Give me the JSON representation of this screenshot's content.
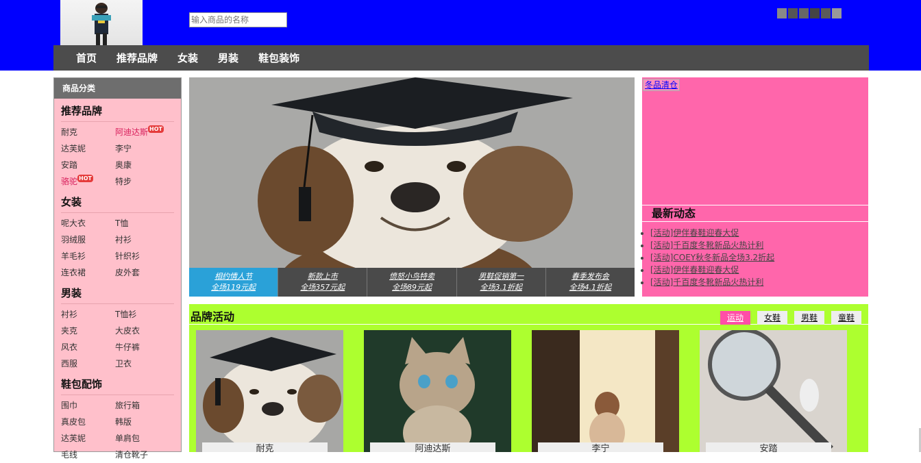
{
  "header": {
    "search_placeholder": "输入商品的名称",
    "nav": [
      "首页",
      "推荐品牌",
      "女装",
      "男装",
      "鞋包装饰"
    ]
  },
  "sidebar": {
    "title": "商品分类",
    "categories": [
      {
        "title": "推荐品牌",
        "items": [
          "耐克",
          "阿迪达斯",
          "达芙妮",
          "李宁",
          "安踏",
          "奥康",
          "骆驼",
          "特步"
        ]
      },
      {
        "title": "女装",
        "items": [
          "呢大衣",
          "T恤",
          "羽绒服",
          "衬衫",
          "羊毛衫",
          "针织衫",
          "连衣裙",
          "皮外套"
        ]
      },
      {
        "title": "男装",
        "items": [
          "衬衫",
          "T恤衫",
          "夹克",
          "大皮衣",
          "风衣",
          "牛仔裤",
          "西服",
          "卫衣"
        ]
      },
      {
        "title": "鞋包配饰",
        "items": [
          "围巾",
          "旅行箱",
          "真皮包",
          "韩版",
          "达芙妮",
          "单肩包",
          "毛线",
          "清仓靴子"
        ]
      }
    ],
    "hot_label": "HOT"
  },
  "banner": {
    "tabs": [
      {
        "line1": "相约情人节",
        "line2": "全场119元起"
      },
      {
        "line1": "新款上市",
        "line2": "全场357元起"
      },
      {
        "line1": "愤怒小鸟特卖",
        "line2": "全场89元起"
      },
      {
        "line1": "男鞋促销第一",
        "line2": "全场3.1折起"
      },
      {
        "line1": "春季发布会",
        "line2": "全场4.1折起"
      }
    ]
  },
  "ad": {
    "image_alt": "冬品清仓",
    "news_title": "最新动态",
    "news": [
      "[活动]伊伴春鞋迎春大促",
      "[活动]千百度冬靴新品火热计利",
      "[活动]COEY秋冬新品全场3.2折起",
      "[活动]伊伴春鞋迎春大促",
      "[活动]千百度冬靴新品火热计利"
    ]
  },
  "brand": {
    "title": "品牌活动",
    "tabs": [
      "运动",
      "女鞋",
      "男鞋",
      "童鞋"
    ],
    "cards": [
      "耐克",
      "阿迪达斯",
      "李宁",
      "安踏"
    ]
  }
}
